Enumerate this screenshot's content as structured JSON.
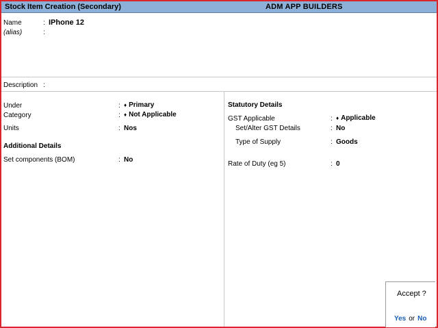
{
  "window": {
    "title": "Stock Item Creation (Secondary)",
    "company": "ADM  APP BUILDERS"
  },
  "colors": {
    "frame_border": "#d9262c",
    "titlebar_bg": "#8db0d8",
    "accept_link": "#1a5fb4"
  },
  "header": {
    "name_label": "Name",
    "name_value": "IPhone 12",
    "alias_label": "(alias)",
    "alias_value": ""
  },
  "description": {
    "label": "Description",
    "value": ""
  },
  "left_panel": {
    "under_label": "Under",
    "under_value": "Primary",
    "category_label": "Category",
    "category_value": "Not Applicable",
    "units_label": "Units",
    "units_value": "Nos",
    "additional_heading": "Additional Details",
    "bom_label": "Set components (BOM)",
    "bom_value": "No"
  },
  "right_panel": {
    "statutory_heading": "Statutory Details",
    "gst_label": "GST Applicable",
    "gst_value": "Applicable",
    "set_alter_label": "Set/Alter GST Details",
    "set_alter_value": "No",
    "supply_label": "Type of Supply",
    "supply_value": "Goods",
    "rate_label": "Rate of Duty (eg 5)",
    "rate_value": "0"
  },
  "accept": {
    "question": "Accept ?",
    "yes": "Yes",
    "or": "or",
    "no": "No"
  },
  "symbols": {
    "colon": ":",
    "diamond": "♦"
  }
}
